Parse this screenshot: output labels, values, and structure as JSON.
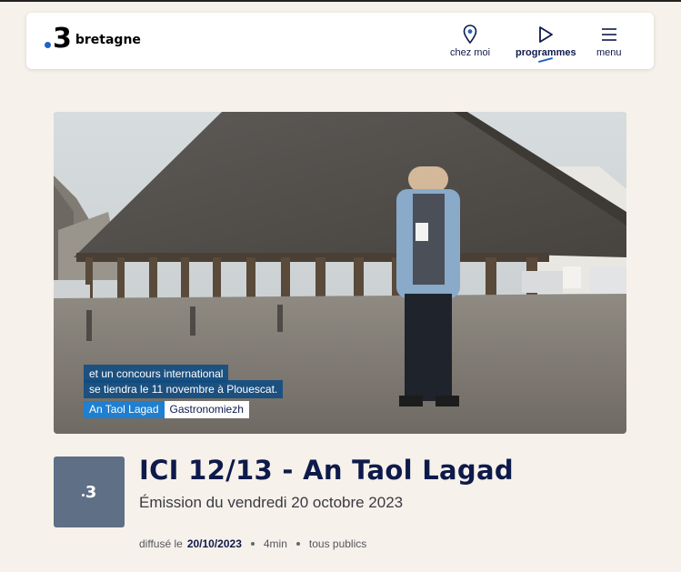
{
  "header": {
    "logo_number": "3",
    "logo_text": "bretagne",
    "nav": [
      {
        "label": "chez moi",
        "icon": "location-pin-icon"
      },
      {
        "label": "programmes",
        "icon": "play-icon"
      },
      {
        "label": "menu",
        "icon": "hamburger-menu-icon"
      }
    ]
  },
  "video": {
    "subtitle_line1": "et un concours international",
    "subtitle_line2": "se tiendra le 11 novembre à Plouescat.",
    "tag_show": "An Taol Lagad",
    "tag_topic": "Gastronomiezh"
  },
  "program": {
    "thumb_number": "3",
    "title": "ICI 12/13 - An Taol Lagad",
    "subtitle": "Émission du vendredi 20 octobre 2023",
    "meta_prefix": "diffusé le",
    "meta_date": "20/10/2023",
    "duration": "4min",
    "audience": "tous publics"
  },
  "colors": {
    "accent": "#1f63c9",
    "page_background": "#f6f1ea",
    "title": "#0e1a4a"
  }
}
